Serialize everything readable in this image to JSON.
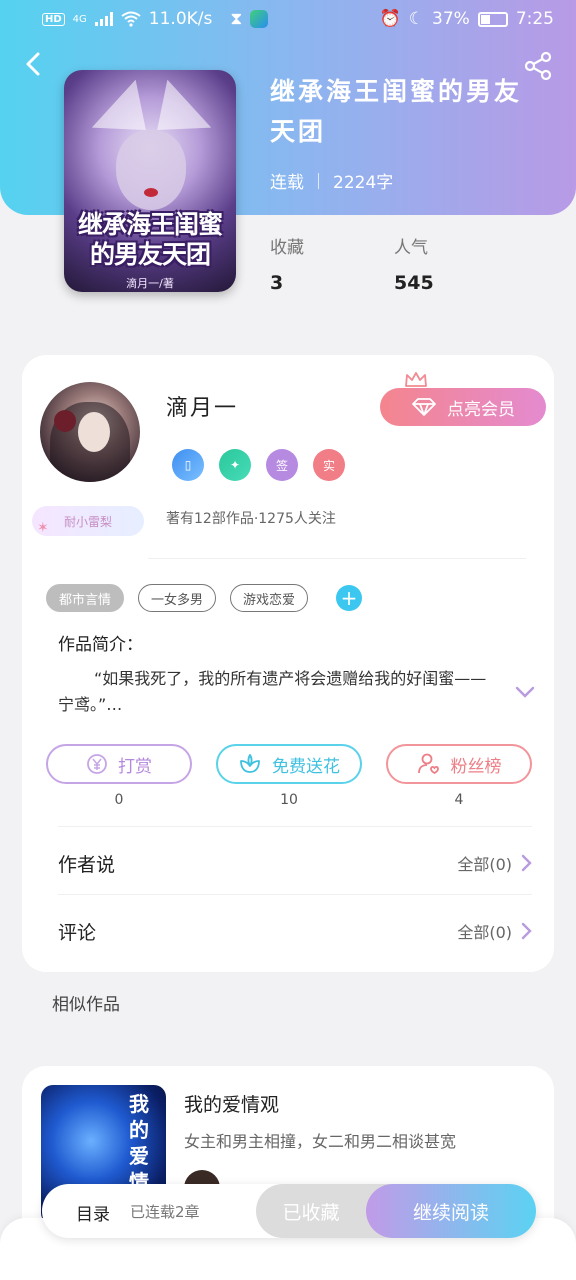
{
  "status_bar": {
    "net_speed": "11.0K/s",
    "battery": "37%",
    "time": "7:25",
    "hd": "HD",
    "signal": "4G"
  },
  "book": {
    "title": "继承海王闺蜜的男友天团",
    "status": "连载",
    "word_count": "2224字",
    "cover_title": "继承海王闺蜜的男友天团",
    "cover_author": "滴月一/著",
    "stats": [
      {
        "label": "收藏",
        "value": "3"
      },
      {
        "label": "人气",
        "value": "545"
      }
    ]
  },
  "author": {
    "name": "滴月一",
    "nickname_tag": "耐小雷梨",
    "vip_button": "点亮会员",
    "badges": [
      "",
      "",
      "签",
      "实"
    ],
    "info": "著有12部作品·1275人关注"
  },
  "tags": [
    "都市言情",
    "一女多男",
    "游戏恋爱"
  ],
  "intro": {
    "label": "作品简介：",
    "text": "“如果我死了，我的所有遗产将会遗赠给我的好闺蜜——宁鸢。”…"
  },
  "actions": [
    {
      "label": "打赏",
      "count": "0"
    },
    {
      "label": "免费送花",
      "count": "10"
    },
    {
      "label": "粉丝榜",
      "count": "4"
    }
  ],
  "rows": [
    {
      "label": "作者说",
      "all": "全部(0)"
    },
    {
      "label": "评论",
      "all": "全部(0)"
    }
  ],
  "similar": {
    "title": "相似作品",
    "item": {
      "title": "我的爱情观",
      "desc": "女主和男主相撞，女二和男二相谈甚宽",
      "cover_text": "我的爱情"
    }
  },
  "bottom": {
    "toc": "目录",
    "toc_status": "已连载2章",
    "collected": "已收藏",
    "read": "继续阅读"
  },
  "colors": {
    "header_start": "#55d2f0",
    "header_end": "#b89ae6",
    "accent_pink": "#f4858e",
    "accent_cyan": "#3bc7f0"
  }
}
